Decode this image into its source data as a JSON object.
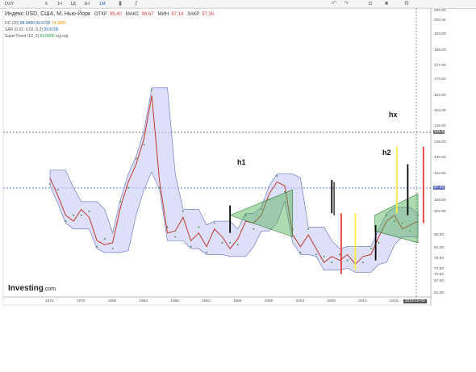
{
  "toolbar": {
    "symbol": "DXY",
    "intervals": [
      "5",
      "1ч",
      "1Д",
      "1Н",
      "1M"
    ],
    "icons": [
      "candles-icon",
      "indicators-icon",
      "undo-icon",
      "redo-icon",
      "camera-icon",
      "color-icon",
      "settings-icon"
    ]
  },
  "header": {
    "title": "Индекс USD, США, М, Нью-Йорк",
    "open_label": "ОТКР",
    "open": "99,40",
    "high_label": "МАКС",
    "high": "99,67",
    "low_label": "МИН",
    "low": "97,14",
    "close_label": "ЗАКР",
    "close": "97,35"
  },
  "indicators": [
    {
      "name": "DC (20)",
      "v1": "88.9400",
      "v2": "99.6700",
      "v3": "74.3050"
    },
    {
      "name": "SAR (0.02, 0.02, 0.2)",
      "v1": "99.6700"
    },
    {
      "name": "SuperTrend (10, 3)",
      "v1": "93.0800",
      "v2": "н/д",
      "v3": "н/д"
    }
  ],
  "y_axis": [
    "205.00",
    "200.00",
    "193.00",
    "185.00",
    "177.00",
    "170.00",
    "162.00",
    "154.00",
    "146.00",
    "138.00",
    "130.00",
    "122.00",
    "114.50",
    "108.50",
    "102.50",
    "97.42",
    "90.50",
    "84.00",
    "78.50",
    "73.50",
    "70.50",
    "67.00",
    "61.00"
  ],
  "price_tags": {
    "current": "97.42",
    "hline": "121.5"
  },
  "x_axis": [
    "1972",
    "1976",
    "1980",
    "1984",
    "1988",
    "1992",
    "1996",
    "2000",
    "2004",
    "2008",
    "2012",
    "2016"
  ],
  "date_tag": "2019-10-01",
  "annotations": {
    "h1": "h1",
    "h2": "h2",
    "hx": "hx"
  },
  "logo": {
    "brand": "Investing",
    "suffix": ".com"
  },
  "colors": {
    "price": "#c0392b",
    "sar_dots": "#2e7d32",
    "channel_fill": "#c8ccf5",
    "channel_line": "#5c6bc0",
    "supertrend": "#1b5e20",
    "red_bar": "#e53935",
    "yellow_bar": "#ffeb3b",
    "black_bar": "#000000"
  },
  "chart_data": {
    "type": "line",
    "title": "Индекс USD, США, М, Нью-Йорк",
    "xlabel": "",
    "ylabel": "",
    "ylim": [
      61,
      205
    ],
    "x": [
      1972,
      1973,
      1974,
      1975,
      1976,
      1977,
      1978,
      1979,
      1980,
      1981,
      1982,
      1983,
      1984,
      1985,
      1986,
      1987,
      1988,
      1989,
      1990,
      1991,
      1992,
      1993,
      1994,
      1995,
      1996,
      1997,
      1998,
      1999,
      2000,
      2001,
      2002,
      2003,
      2004,
      2005,
      2006,
      2007,
      2008,
      2009,
      2010,
      2011,
      2012,
      2013,
      2014,
      2015,
      2016,
      2017,
      2018,
      2019
    ],
    "series": [
      {
        "values": [
          120,
          111,
          101,
          98,
          104,
          100,
          88,
          86,
          87,
          105,
          118,
          127,
          140,
          162,
          118,
          92,
          93,
          100,
          88,
          92,
          85,
          94,
          90,
          84,
          89,
          98,
          97,
          101,
          112,
          118,
          116,
          91,
          85,
          91,
          84,
          77,
          80,
          78,
          81,
          76,
          80,
          81,
          90,
          98,
          101,
          94,
          96,
          98
        ]
      }
    ],
    "markers": [
      {
        "label": "h1",
        "x": 1995,
        "y": 97
      },
      {
        "label": "h2",
        "x": 2015,
        "y": 110
      },
      {
        "label": "hx",
        "x": 2016,
        "y": 128
      }
    ]
  }
}
